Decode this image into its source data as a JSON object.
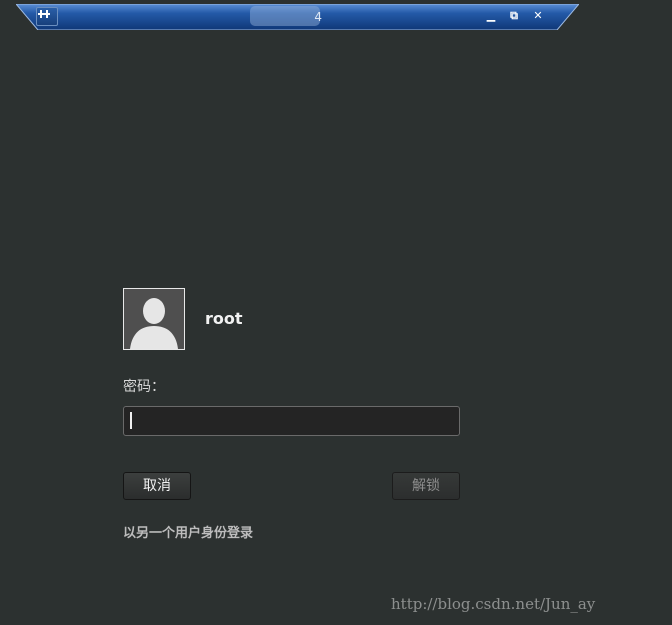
{
  "remote_bar": {
    "title_suffix": "4",
    "minimize_glyph": "▁",
    "restore_glyph": "⧉",
    "close_glyph": "✕"
  },
  "lock": {
    "username": "root",
    "password_label": "密码：",
    "password_value": "",
    "cancel_label": "取消",
    "unlock_label": "解锁",
    "other_user_link": "以另一个用户身份登录"
  },
  "watermark": "http://blog.csdn.net/Jun_ay",
  "colors": {
    "background": "#2c3130",
    "toolbar_blue": "#1e4f96",
    "input_bg": "#242424"
  },
  "icons": {
    "pin": "pin-icon",
    "avatar": "user-silhouette-icon"
  }
}
